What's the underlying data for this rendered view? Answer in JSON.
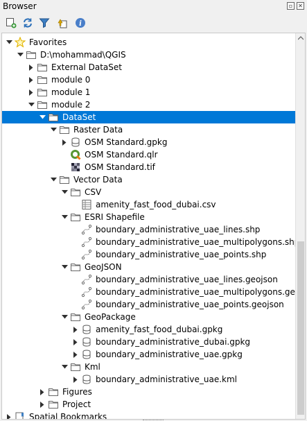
{
  "panel": {
    "title": "Browser"
  },
  "toolbar": {
    "buttons": [
      {
        "name": "add-layer-button",
        "icon": "add-layer-icon"
      },
      {
        "name": "refresh-button",
        "icon": "refresh-icon"
      },
      {
        "name": "filter-button",
        "icon": "filter-icon"
      },
      {
        "name": "collapse-all-button",
        "icon": "collapse-all-icon"
      },
      {
        "name": "properties-button",
        "icon": "info-icon"
      }
    ]
  },
  "colors": {
    "selection": "#0078d7",
    "folder": "#666666",
    "star": "#f5c400"
  },
  "tree": {
    "rows": [
      {
        "label": "Favorites",
        "depth": 0,
        "arrow": "down",
        "icon": "star-icon"
      },
      {
        "label": "D:\\mohammad\\QGIS",
        "depth": 1,
        "arrow": "down",
        "icon": "folder-icon"
      },
      {
        "label": "External DataSet",
        "depth": 2,
        "arrow": "right",
        "icon": "folder-icon"
      },
      {
        "label": "module 0",
        "depth": 2,
        "arrow": "right",
        "icon": "folder-icon"
      },
      {
        "label": "module 1",
        "depth": 2,
        "arrow": "right",
        "icon": "folder-icon"
      },
      {
        "label": "module 2",
        "depth": 2,
        "arrow": "down",
        "icon": "folder-icon"
      },
      {
        "label": "DataSet",
        "depth": 3,
        "arrow": "down",
        "icon": "folder-icon",
        "selected": true
      },
      {
        "label": "Raster Data",
        "depth": 4,
        "arrow": "down",
        "icon": "folder-icon"
      },
      {
        "label": "OSM Standard.gpkg",
        "depth": 5,
        "arrow": "right",
        "icon": "database-icon"
      },
      {
        "label": "OSM Standard.qlr",
        "depth": 5,
        "arrow": "none",
        "icon": "qgis-icon"
      },
      {
        "label": "OSM Standard.tif",
        "depth": 5,
        "arrow": "none",
        "icon": "raster-icon"
      },
      {
        "label": "Vector Data",
        "depth": 4,
        "arrow": "down",
        "icon": "folder-icon"
      },
      {
        "label": "CSV",
        "depth": 5,
        "arrow": "down",
        "icon": "folder-icon"
      },
      {
        "label": "amenity_fast_food_dubai.csv",
        "depth": 6,
        "arrow": "none",
        "icon": "table-icon"
      },
      {
        "label": "ESRI Shapefile",
        "depth": 5,
        "arrow": "down",
        "icon": "folder-icon"
      },
      {
        "label": "boundary_administrative_uae_lines.shp",
        "depth": 6,
        "arrow": "none",
        "icon": "vector-icon"
      },
      {
        "label": "boundary_administrative_uae_multipolygons.shp",
        "depth": 6,
        "arrow": "none",
        "icon": "vector-icon"
      },
      {
        "label": "boundary_administrative_uae_points.shp",
        "depth": 6,
        "arrow": "none",
        "icon": "vector-icon"
      },
      {
        "label": "GeoJSON",
        "depth": 5,
        "arrow": "down",
        "icon": "folder-icon"
      },
      {
        "label": "boundary_administrative_uae_lines.geojson",
        "depth": 6,
        "arrow": "none",
        "icon": "vector-icon"
      },
      {
        "label": "boundary_administrative_uae_multipolygons.geojson",
        "depth": 6,
        "arrow": "none",
        "icon": "vector-icon"
      },
      {
        "label": "boundary_administrative_uae_points.geojson",
        "depth": 6,
        "arrow": "none",
        "icon": "vector-icon"
      },
      {
        "label": "GeoPackage",
        "depth": 5,
        "arrow": "down",
        "icon": "folder-icon"
      },
      {
        "label": "amenity_fast_food_dubai.gpkg",
        "depth": 6,
        "arrow": "right",
        "icon": "database-icon"
      },
      {
        "label": "boundary_administrative_dubai.gpkg",
        "depth": 6,
        "arrow": "right",
        "icon": "database-icon"
      },
      {
        "label": "boundary_administrative_uae.gpkg",
        "depth": 6,
        "arrow": "right",
        "icon": "database-icon"
      },
      {
        "label": "Kml",
        "depth": 5,
        "arrow": "down",
        "icon": "folder-icon"
      },
      {
        "label": "boundary_administrative_uae.kml",
        "depth": 6,
        "arrow": "right",
        "icon": "database-icon"
      },
      {
        "label": "Figures",
        "depth": 3,
        "arrow": "right",
        "icon": "folder-icon"
      },
      {
        "label": "Project",
        "depth": 3,
        "arrow": "right",
        "icon": "folder-icon"
      },
      {
        "label": "Spatial Bookmarks",
        "depth": 0,
        "arrow": "right",
        "icon": "bookmark-icon"
      }
    ]
  }
}
